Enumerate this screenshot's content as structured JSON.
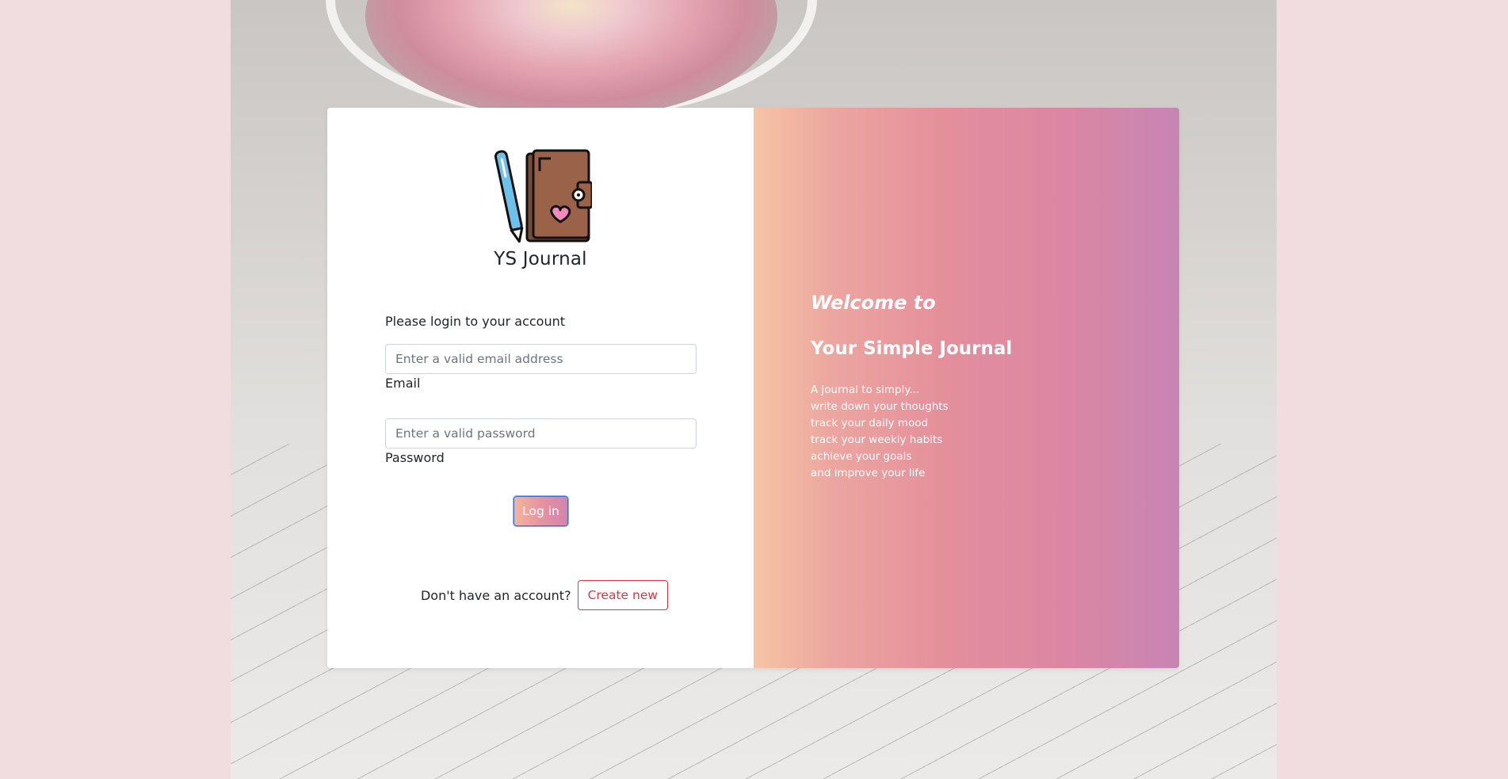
{
  "brand": {
    "name": "YS Journal",
    "logo_icon": "journal-with-pen-icon"
  },
  "login": {
    "prompt": "Please login to your account",
    "email_placeholder": "Enter a valid email address",
    "email_value": "",
    "email_label": "Email",
    "password_placeholder": "Enter a valid password",
    "password_value": "",
    "password_label": "Password",
    "login_button": "Log in"
  },
  "signup": {
    "question": "Don't have an account?",
    "create_button": "Create new"
  },
  "welcome": {
    "heading": "Welcome to",
    "title": "Your Simple Journal",
    "lines": [
      "A journal to simply...",
      "write down your thoughts",
      "track your daily mood",
      "track your weekly habits",
      "achieve your goals",
      "and improve your life"
    ]
  },
  "colors": {
    "page_background": "#f1dde0",
    "accent_gradient_start": "#f6c5a4",
    "accent_gradient_end": "#c785b4",
    "create_button": "#dc3545"
  }
}
